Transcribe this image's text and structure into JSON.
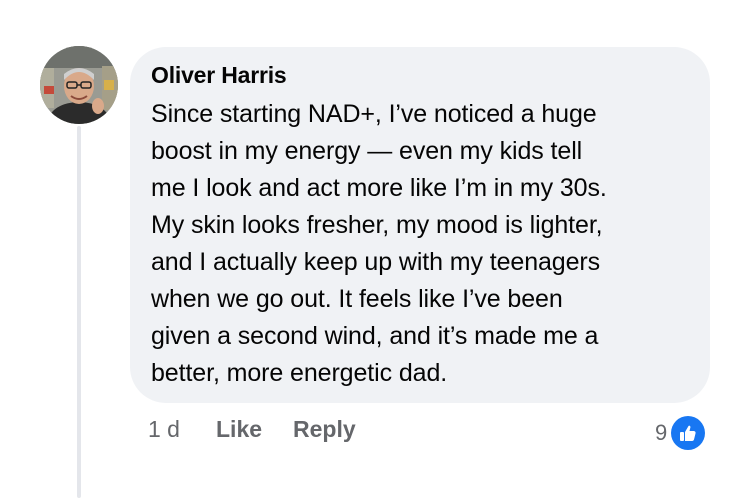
{
  "comment": {
    "author": "Oliver Harris",
    "text_lines": [
      "Since starting NAD+, I’ve noticed a huge",
      "boost in my energy — even my kids tell",
      "me I look and act more like I’m in my 30s.",
      "My skin looks fresher, my mood is lighter,",
      "and I actually keep up with my teenagers",
      "when we go out. It feels like I’ve been",
      "given a second wind, and it’s made me a",
      "better, more energetic dad."
    ],
    "timestamp": "1 d",
    "like_label": "Like",
    "reply_label": "Reply",
    "reaction_count": "9",
    "reaction_icon": "thumbs-up-icon"
  },
  "colors": {
    "bubble_bg": "#f0f2f5",
    "text": "#050505",
    "secondary_text": "#65676b",
    "like_blue": "#1877f2",
    "thread_line": "#e4e6eb"
  }
}
